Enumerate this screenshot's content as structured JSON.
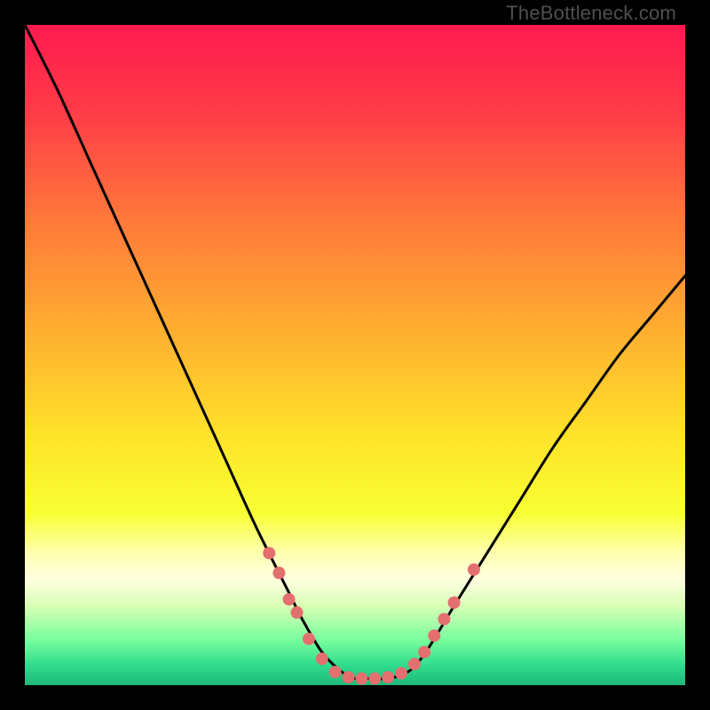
{
  "watermark": "TheBottleneck.com",
  "chart_data": {
    "type": "line",
    "title": "",
    "xlabel": "",
    "ylabel": "",
    "xlim": [
      0,
      100
    ],
    "ylim": [
      0,
      100
    ],
    "curve": {
      "name": "bottleneck-curve",
      "x": [
        0,
        5,
        10,
        15,
        20,
        25,
        30,
        35,
        40,
        42,
        45,
        48,
        50,
        52,
        55,
        58,
        60,
        62,
        65,
        70,
        75,
        80,
        85,
        90,
        95,
        100
      ],
      "y": [
        100,
        90,
        79,
        68,
        57,
        46,
        35,
        24,
        14,
        10,
        5,
        2,
        1,
        1,
        1,
        2,
        4,
        7,
        12,
        20,
        28,
        36,
        43,
        50,
        56,
        62
      ]
    },
    "markers": {
      "name": "data-points",
      "color": "#e46f6f",
      "radius": 7,
      "x": [
        37,
        38.5,
        40,
        41.2,
        43,
        45,
        47,
        49,
        51,
        53,
        55,
        57,
        59,
        60.5,
        62,
        63.5,
        65,
        68
      ],
      "y": [
        20,
        17,
        13,
        11,
        7,
        4,
        2,
        1.2,
        1,
        1,
        1.2,
        1.8,
        3.2,
        5,
        7.5,
        10,
        12.5,
        17.5
      ]
    },
    "gradient_stops": [
      {
        "offset": 0.0,
        "color": "#ff1a4f"
      },
      {
        "offset": 0.13,
        "color": "#ff3b47"
      },
      {
        "offset": 0.3,
        "color": "#ff7a3a"
      },
      {
        "offset": 0.48,
        "color": "#ffb42f"
      },
      {
        "offset": 0.62,
        "color": "#ffe22a"
      },
      {
        "offset": 0.74,
        "color": "#f8ff33"
      },
      {
        "offset": 0.8,
        "color": "#ffffb0"
      },
      {
        "offset": 0.84,
        "color": "#ffffe0"
      },
      {
        "offset": 0.88,
        "color": "#d8ffb5"
      },
      {
        "offset": 0.93,
        "color": "#7bff9e"
      },
      {
        "offset": 0.97,
        "color": "#2fdc8c"
      },
      {
        "offset": 1.0,
        "color": "#1fb87a"
      }
    ]
  }
}
